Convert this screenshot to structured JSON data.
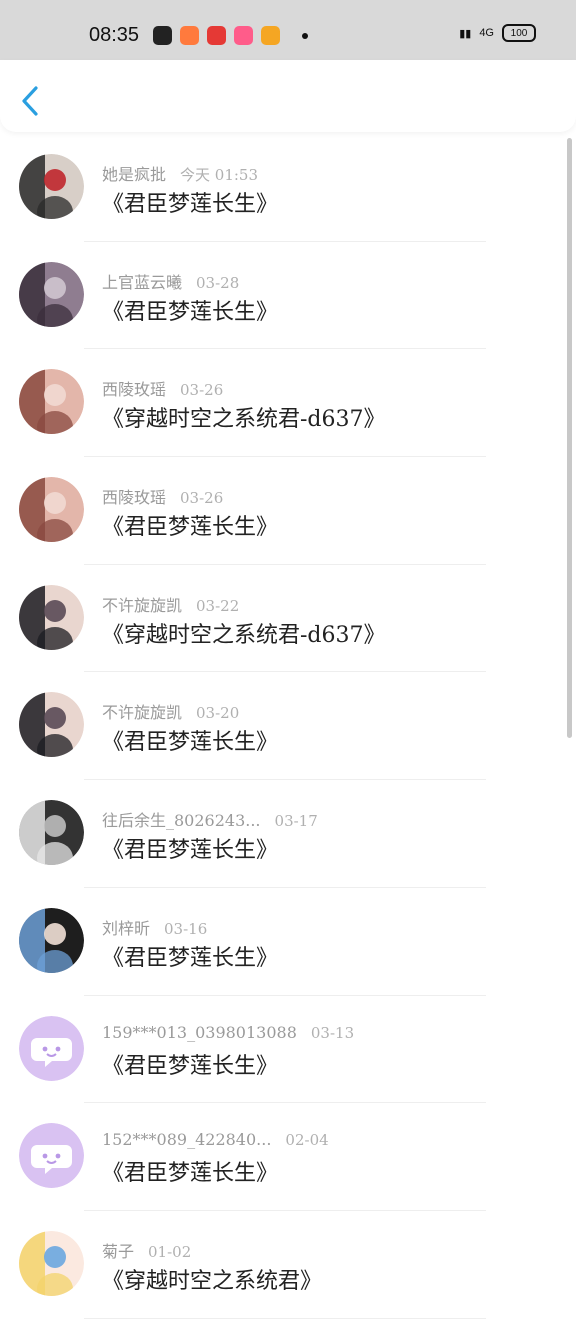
{
  "status_bar": {
    "time": "08:35",
    "apps": [
      {
        "icon": "wechat-icon",
        "color": "#222222"
      },
      {
        "icon": "reader-app-icon",
        "color": "#ff7a3d"
      },
      {
        "icon": "chat-app-icon",
        "color": "#e53935"
      },
      {
        "icon": "store-app-icon",
        "color": "#ff5c8a"
      },
      {
        "icon": "weibo-icon",
        "color": "#f5a623"
      }
    ],
    "network": "4G",
    "battery": "100"
  },
  "header": {
    "back_icon": "chevron-left-icon",
    "accent": "#2a9fe0"
  },
  "messages": [
    {
      "user": "她是疯批",
      "date": "今天 01:53",
      "title": "《君臣梦莲长生》",
      "avatar": "photo-red",
      "avatar_colors": [
        "#2a2a2a",
        "#d8cfc8",
        "#c0262c"
      ]
    },
    {
      "user": "上官蓝云曦",
      "date": "03-28",
      "title": "《君臣梦莲长生》",
      "avatar": "photo-dark",
      "avatar_colors": [
        "#3b2f3c",
        "#8f7d90",
        "#cfc5cf"
      ]
    },
    {
      "user": "西陵玫瑶",
      "date": "03-26",
      "title": "《穿越时空之系统君-d637》",
      "avatar": "photo-pink",
      "avatar_colors": [
        "#8a4a40",
        "#e3b6aa",
        "#f1d9d2"
      ]
    },
    {
      "user": "西陵玫瑶",
      "date": "03-26",
      "title": "《君臣梦莲长生》",
      "avatar": "photo-pink",
      "avatar_colors": [
        "#8a4a40",
        "#e3b6aa",
        "#f1d9d2"
      ]
    },
    {
      "user": "不许旋旋凯",
      "date": "03-22",
      "title": "《穿越时空之系统君-d637》",
      "avatar": "photo-couple",
      "avatar_colors": [
        "#1c1c22",
        "#e9d6cf",
        "#5a4a55"
      ]
    },
    {
      "user": "不许旋旋凯",
      "date": "03-20",
      "title": "《君臣梦莲长生》",
      "avatar": "photo-couple",
      "avatar_colors": [
        "#1c1c22",
        "#e9d6cf",
        "#5a4a55"
      ]
    },
    {
      "user": "往后余生_8026243...",
      "date": "03-17",
      "title": "《君臣梦莲长生》",
      "avatar": "photo-wedding",
      "avatar_colors": [
        "#e7e7e7",
        "#333333",
        "#bdbdbd"
      ]
    },
    {
      "user": "刘梓昕",
      "date": "03-16",
      "title": "《君臣梦莲长生》",
      "avatar": "photo-sky",
      "avatar_colors": [
        "#6c9fd6",
        "#1e1e1e",
        "#f1e0d6"
      ]
    },
    {
      "user": "159***013_0398013088",
      "date": "03-13",
      "title": "《君臣梦莲长生》",
      "avatar": "default-chat",
      "avatar_colors": [
        "#d9c2f2",
        "#ffffff",
        "#b998e6"
      ]
    },
    {
      "user": "152***089_422840...",
      "date": "02-04",
      "title": "《君臣梦莲长生》",
      "avatar": "default-chat",
      "avatar_colors": [
        "#d9c2f2",
        "#ffffff",
        "#b998e6"
      ]
    },
    {
      "user": "菊子",
      "date": "01-02",
      "title": "《穿越时空之系统君》",
      "avatar": "photo-anime",
      "avatar_colors": [
        "#f3d36b",
        "#fbe9e0",
        "#6aa7e0"
      ]
    }
  ]
}
